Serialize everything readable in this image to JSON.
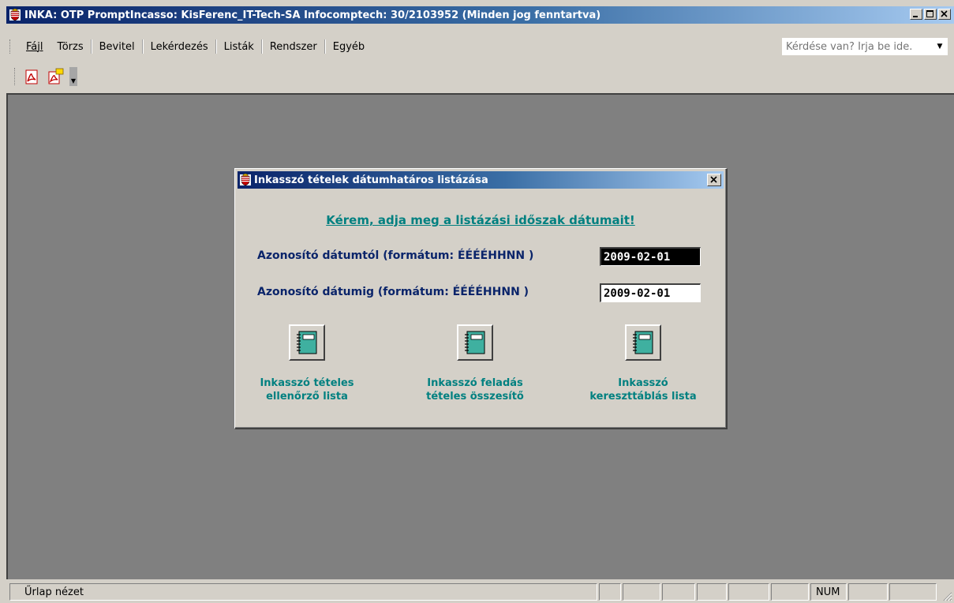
{
  "window": {
    "title": "INKA: OTP PromptIncasso: KisFerenc_IT-Tech-SA Infocomptech: 30/2103952 (Minden jog fenntartva)",
    "icon": "hungarian-crest-icon"
  },
  "menubar": {
    "items": [
      {
        "label": "Fájl"
      },
      {
        "label": "Törzs"
      },
      {
        "label": "Bevitel"
      },
      {
        "label": "Lekérdezés"
      },
      {
        "label": "Listák"
      },
      {
        "label": "Rendszer"
      },
      {
        "label": "Egyéb"
      }
    ],
    "help_placeholder": "Kérdése van? Írja be ide."
  },
  "toolbar": {
    "buttons": [
      {
        "icon": "pdf-icon"
      },
      {
        "icon": "pdf-export-icon"
      }
    ]
  },
  "dialog": {
    "title": "Inkasszó tételek dátumhatáros listázása",
    "heading": "Kérem, adja meg a listázási időszak dátumait!",
    "from_label": "Azonosító dátumtól (formátum: ÉÉÉÉHHNN )",
    "from_value": "2009-02-01",
    "to_label": "Azonosító dátumig  (formátum: ÉÉÉÉHHNN )",
    "to_value": "2009-02-01",
    "buttons": [
      {
        "line1": "Inkasszó tételes",
        "line2": "ellenőrző lista",
        "icon": "report-notebook-icon"
      },
      {
        "line1": "Inkasszó feladás",
        "line2": "tételes összesítő",
        "icon": "report-notebook-icon"
      },
      {
        "line1": "Inkasszó",
        "line2": "kereszttáblás lista",
        "icon": "report-notebook-icon"
      }
    ]
  },
  "statusbar": {
    "text": "Űrlap nézet",
    "num": "NUM"
  },
  "colors": {
    "titlebar_start": "#0a246a",
    "titlebar_end": "#a6caf0",
    "workspace": "#808080",
    "accent_teal": "#008080",
    "label_navy": "#0a246a"
  }
}
